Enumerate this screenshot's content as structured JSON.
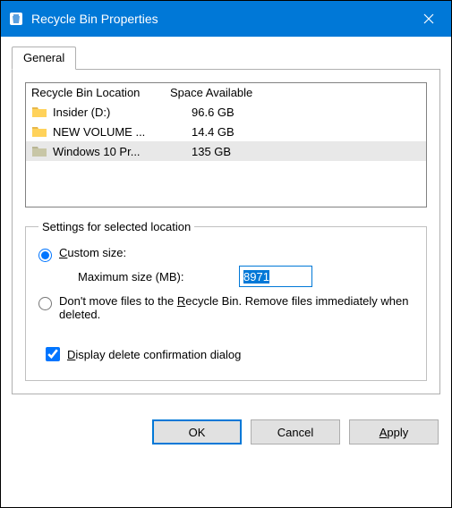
{
  "titlebar": {
    "title": "Recycle Bin Properties"
  },
  "tabs": {
    "general": "General"
  },
  "list": {
    "head_location": "Recycle Bin Location",
    "head_space": "Space Available",
    "rows": [
      {
        "name": "Insider (D:)",
        "space": "96.6 GB"
      },
      {
        "name": "NEW VOLUME ...",
        "space": "14.4 GB"
      },
      {
        "name": "Windows 10 Pr...",
        "space": "135 GB"
      }
    ]
  },
  "settings": {
    "legend": "Settings for selected location",
    "custom_size_label_pre": "C",
    "custom_size_label_rest": "ustom size:",
    "max_label": "Maximum size (MB):",
    "max_value": "8971",
    "dont_move_pre": "Don't move files to the ",
    "dont_move_u": "R",
    "dont_move_rest": "ecycle Bin. Remove files immediately when deleted.",
    "display_pre": "D",
    "display_rest": "isplay delete confirmation dialog"
  },
  "buttons": {
    "ok": "OK",
    "cancel": "Cancel",
    "apply_pre": "A",
    "apply_rest": "pply"
  }
}
